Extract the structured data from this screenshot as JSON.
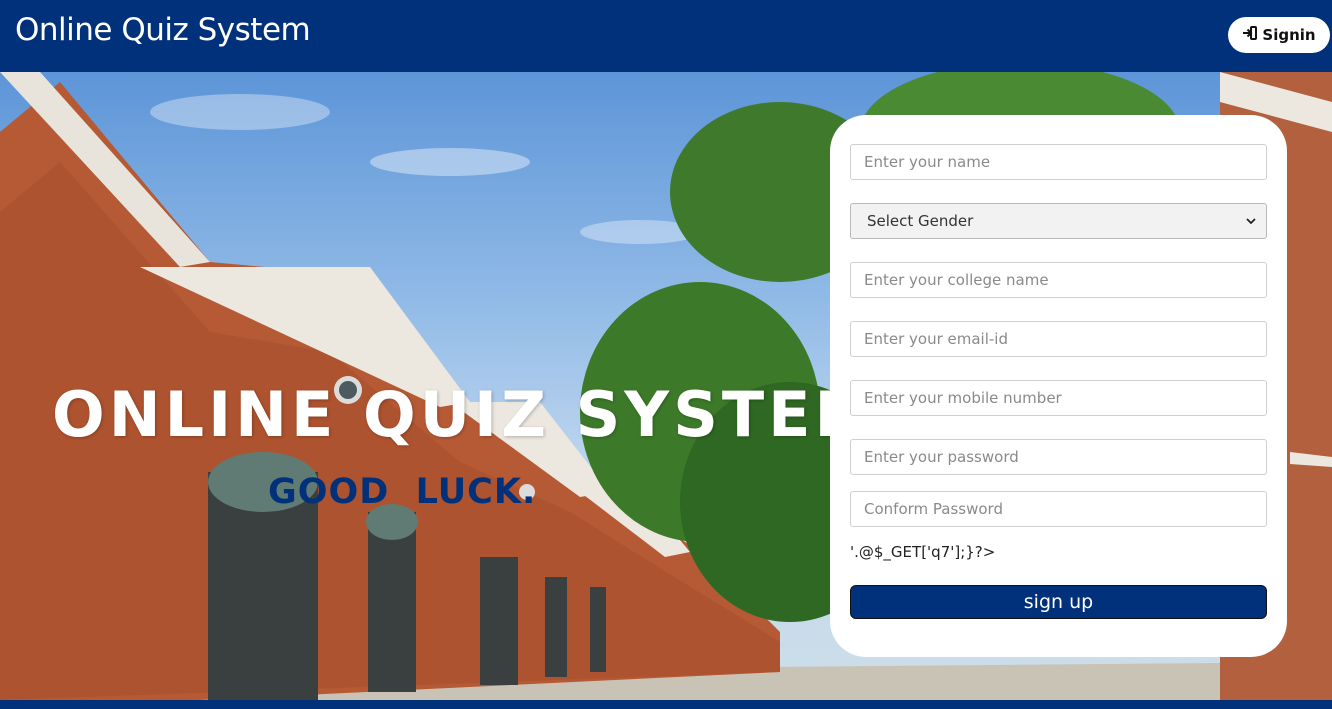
{
  "header": {
    "brand": "Online Quiz System",
    "signin_label": "Signin"
  },
  "hero": {
    "title": "ONLINE QUIZ SYSTEM",
    "subtitle": "GOOD  LUCK."
  },
  "form": {
    "name_placeholder": "Enter your name",
    "gender_selected": "Select Gender",
    "college_placeholder": "Enter your college name",
    "email_placeholder": "Enter your email-id",
    "mobile_placeholder": "Enter your mobile number",
    "password_placeholder": "Enter your password",
    "confirm_placeholder": "Conform Password",
    "php_text": "'.@$_GET['q7'];}?>",
    "signup_label": "sign up"
  },
  "colors": {
    "brand_blue": "#00317a",
    "card_bg": "#ffffff"
  },
  "icons": {
    "signin": "sign-in-icon",
    "select": "chevron-down-icon"
  }
}
